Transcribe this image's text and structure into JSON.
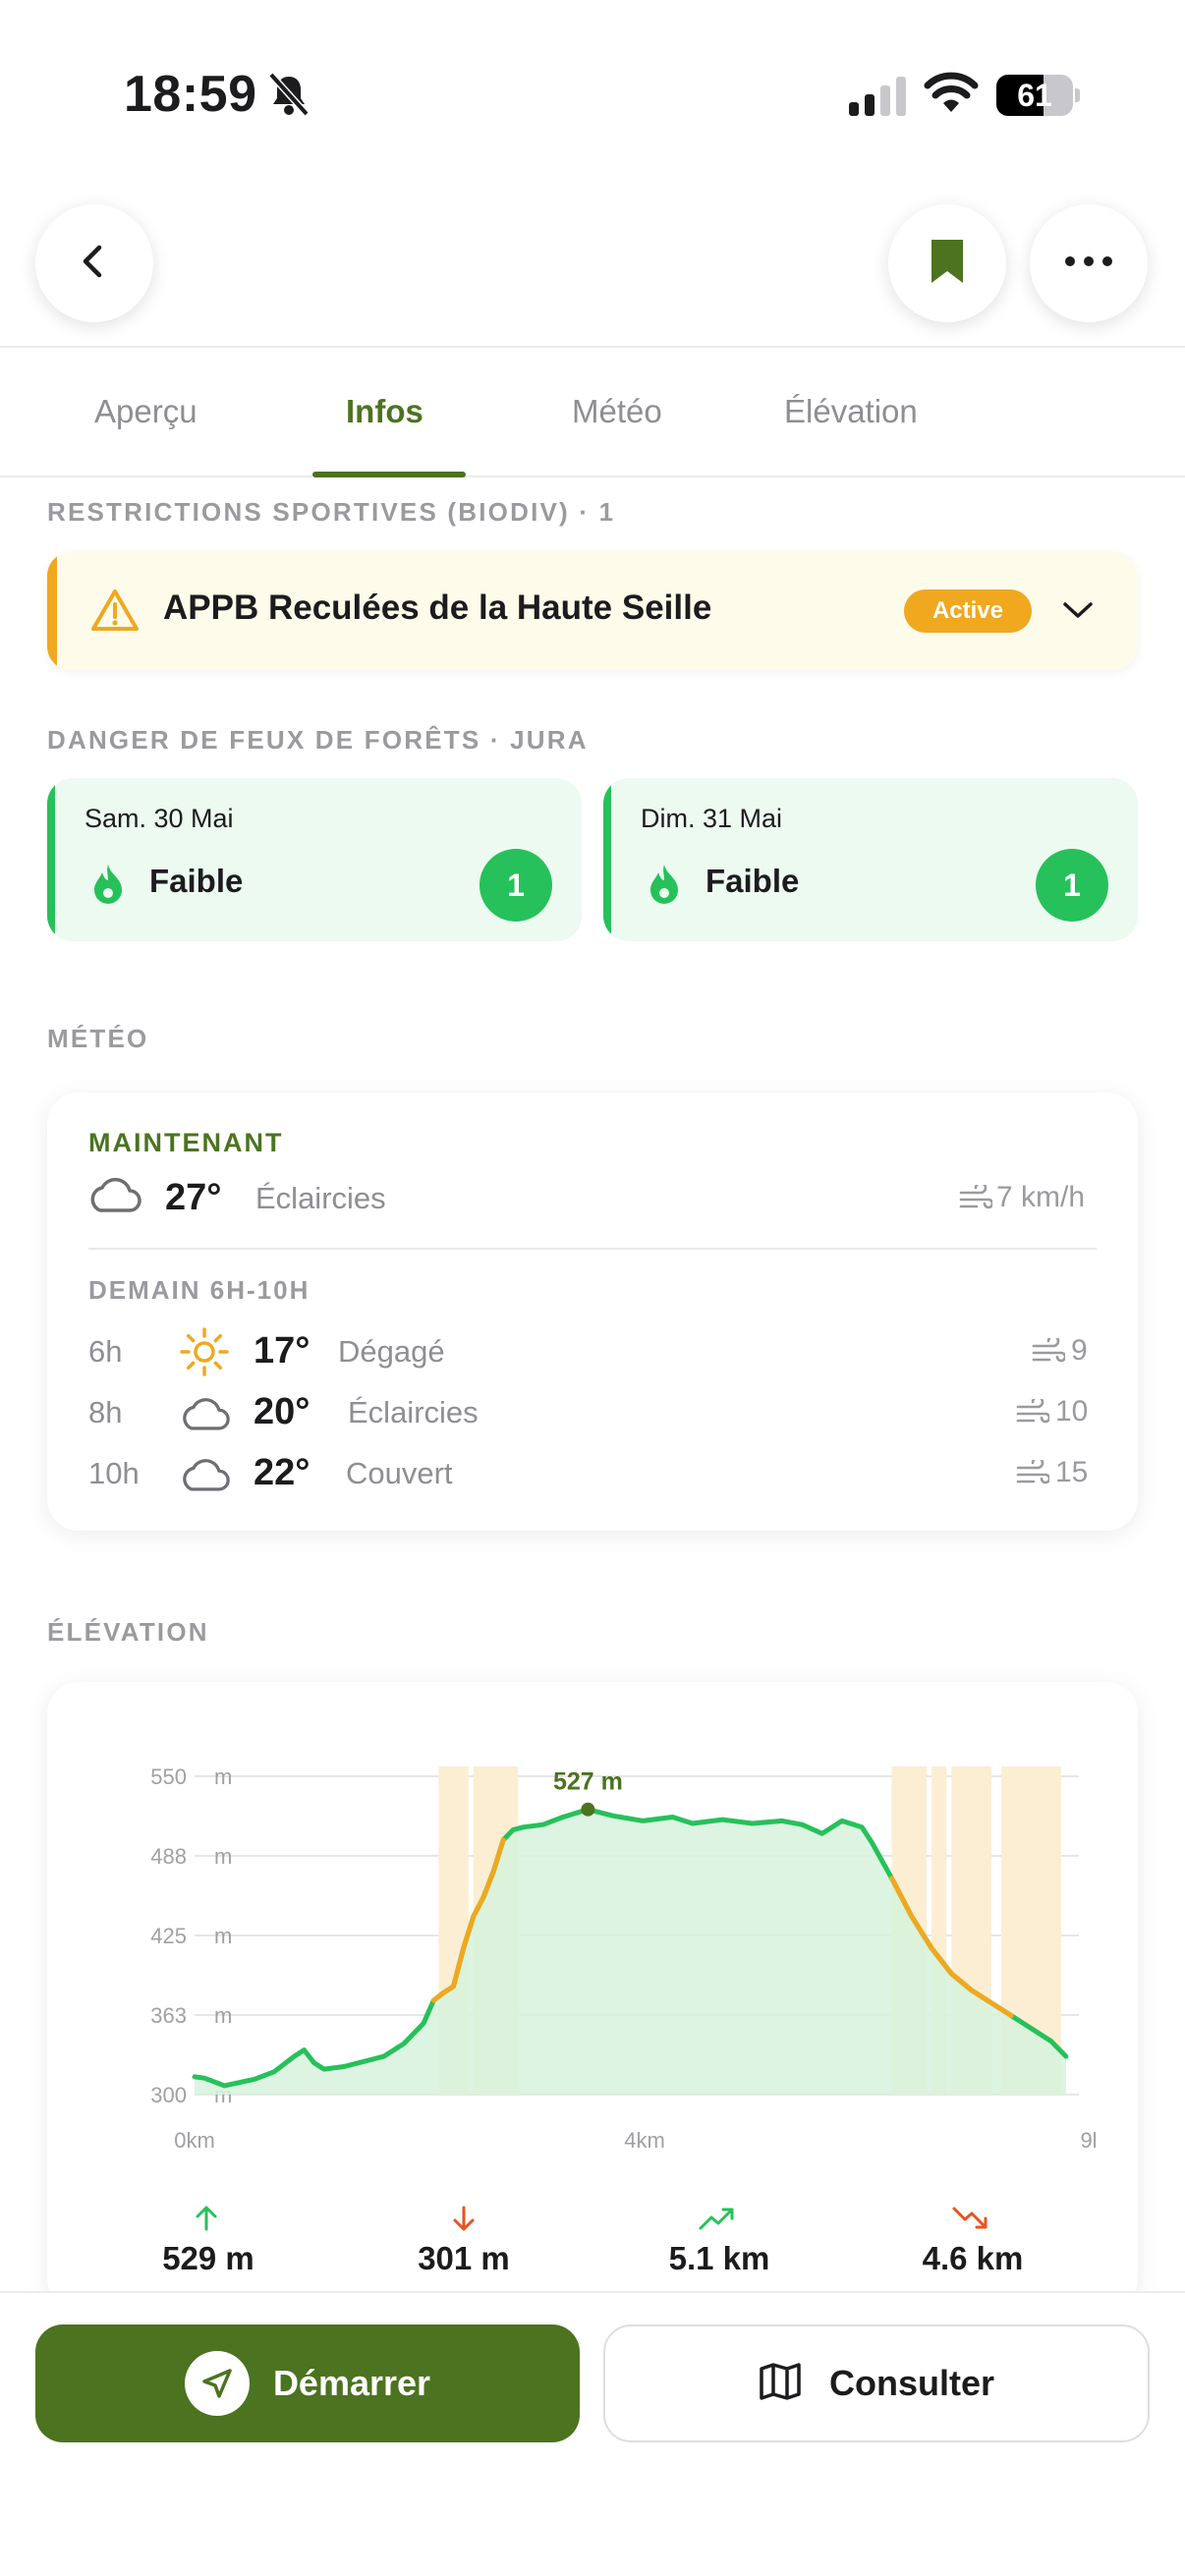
{
  "status_bar": {
    "time": "18:59",
    "battery": "61",
    "battery_level": 0.61
  },
  "tabs": [
    {
      "label": "Aperçu"
    },
    {
      "label": "Infos"
    },
    {
      "label": "Météo"
    },
    {
      "label": "Élévation"
    }
  ],
  "active_tab": "Infos",
  "restrictions": {
    "section_label": "RESTRICTIONS SPORTIVES (BIODIV) · 1",
    "item": {
      "title": "APPB Reculées de la Haute Seille",
      "badge": "Active"
    }
  },
  "fire_danger": {
    "section_label": "DANGER DE FEUX DE FORÊTS · JURA",
    "days": [
      {
        "date": "Sam. 30 Mai",
        "level": "Faible",
        "index": "1"
      },
      {
        "date": "Dim. 31 Mai",
        "level": "Faible",
        "index": "1"
      }
    ]
  },
  "weather": {
    "section_label": "MÉTÉO",
    "now": {
      "label": "MAINTENANT",
      "temp": "27°",
      "condition": "Éclaircies",
      "wind": "7 km/h",
      "icon": "cloud-icon"
    },
    "tomorrow_label": "DEMAIN 6H-10H",
    "forecast": [
      {
        "hour": "6h",
        "temp": "17°",
        "condition": "Dégagé",
        "wind": "9",
        "icon": "sun-icon"
      },
      {
        "hour": "8h",
        "temp": "20°",
        "condition": "Éclaircies",
        "wind": "10",
        "icon": "cloud-icon"
      },
      {
        "hour": "10h",
        "temp": "22°",
        "condition": "Couvert",
        "wind": "15",
        "icon": "cloud-icon"
      }
    ]
  },
  "elevation": {
    "section_label": "ÉLÉVATION",
    "stats": [
      {
        "value": "529 m",
        "icon": "arrow-up-icon",
        "color": "#26c15a"
      },
      {
        "value": "301 m",
        "icon": "arrow-down-icon",
        "color": "#e8531f"
      },
      {
        "value": "5.1 km",
        "icon": "trend-up-icon",
        "color": "#26c15a"
      },
      {
        "value": "4.6 km",
        "icon": "trend-down-icon",
        "color": "#e8531f"
      }
    ]
  },
  "chart_data": {
    "type": "area",
    "title": "",
    "xlabel": "",
    "ylabel": "",
    "y_ticks": [
      "550",
      "488",
      "425",
      "363",
      "300"
    ],
    "y_unit": "m",
    "x_ticks": [
      "0km",
      "4km",
      "9l"
    ],
    "ylim": [
      300,
      550
    ],
    "xlim": [
      0,
      8.8
    ],
    "peak_label": "527",
    "peak_unit": "m",
    "peak": {
      "x": 3.95,
      "y": 524
    },
    "series": [
      {
        "x": [
          0,
          0.1,
          0.3,
          0.6,
          0.8,
          1.0,
          1.1,
          1.2,
          1.3,
          1.5,
          1.7,
          1.9,
          2.1,
          2.3,
          2.4,
          2.5,
          2.6,
          2.7,
          2.8,
          2.9,
          3.0,
          3.1,
          3.2,
          3.3,
          3.5,
          3.7,
          3.95,
          4.2,
          4.5,
          4.8,
          5.0,
          5.3,
          5.6,
          5.9,
          6.1,
          6.3,
          6.5,
          6.7,
          6.8,
          7.0,
          7.2,
          7.4,
          7.6,
          7.8,
          8.0,
          8.2,
          8.4,
          8.6,
          8.75
        ],
        "y": [
          314,
          313,
          307,
          312,
          318,
          330,
          335,
          325,
          320,
          322,
          326,
          330,
          340,
          356,
          374,
          380,
          385,
          415,
          440,
          455,
          475,
          500,
          508,
          510,
          512,
          518,
          524,
          519,
          515,
          518,
          513,
          516,
          513,
          515,
          512,
          505,
          515,
          510,
          498,
          470,
          440,
          415,
          395,
          382,
          372,
          362,
          352,
          342,
          330
        ]
      }
    ],
    "grid": true,
    "colors": {
      "line": "#26c15a",
      "fill": "#d6f2dc",
      "highlight": "#fbeed2",
      "steep": "#f0a81f"
    }
  },
  "actions": {
    "start_label": "Démarrer",
    "consult_label": "Consulter"
  },
  "colors": {
    "brand": "#4c7320",
    "green": "#26c15a",
    "orange": "#f0a81f"
  }
}
